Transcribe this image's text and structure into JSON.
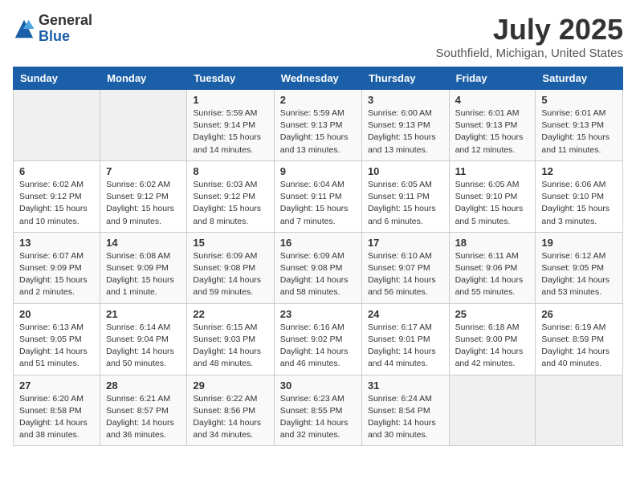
{
  "logo": {
    "general": "General",
    "blue": "Blue"
  },
  "title": "July 2025",
  "location": "Southfield, Michigan, United States",
  "days_of_week": [
    "Sunday",
    "Monday",
    "Tuesday",
    "Wednesday",
    "Thursday",
    "Friday",
    "Saturday"
  ],
  "weeks": [
    [
      {
        "day": "",
        "detail": ""
      },
      {
        "day": "",
        "detail": ""
      },
      {
        "day": "1",
        "detail": "Sunrise: 5:59 AM\nSunset: 9:14 PM\nDaylight: 15 hours\nand 14 minutes."
      },
      {
        "day": "2",
        "detail": "Sunrise: 5:59 AM\nSunset: 9:13 PM\nDaylight: 15 hours\nand 13 minutes."
      },
      {
        "day": "3",
        "detail": "Sunrise: 6:00 AM\nSunset: 9:13 PM\nDaylight: 15 hours\nand 13 minutes."
      },
      {
        "day": "4",
        "detail": "Sunrise: 6:01 AM\nSunset: 9:13 PM\nDaylight: 15 hours\nand 12 minutes."
      },
      {
        "day": "5",
        "detail": "Sunrise: 6:01 AM\nSunset: 9:13 PM\nDaylight: 15 hours\nand 11 minutes."
      }
    ],
    [
      {
        "day": "6",
        "detail": "Sunrise: 6:02 AM\nSunset: 9:12 PM\nDaylight: 15 hours\nand 10 minutes."
      },
      {
        "day": "7",
        "detail": "Sunrise: 6:02 AM\nSunset: 9:12 PM\nDaylight: 15 hours\nand 9 minutes."
      },
      {
        "day": "8",
        "detail": "Sunrise: 6:03 AM\nSunset: 9:12 PM\nDaylight: 15 hours\nand 8 minutes."
      },
      {
        "day": "9",
        "detail": "Sunrise: 6:04 AM\nSunset: 9:11 PM\nDaylight: 15 hours\nand 7 minutes."
      },
      {
        "day": "10",
        "detail": "Sunrise: 6:05 AM\nSunset: 9:11 PM\nDaylight: 15 hours\nand 6 minutes."
      },
      {
        "day": "11",
        "detail": "Sunrise: 6:05 AM\nSunset: 9:10 PM\nDaylight: 15 hours\nand 5 minutes."
      },
      {
        "day": "12",
        "detail": "Sunrise: 6:06 AM\nSunset: 9:10 PM\nDaylight: 15 hours\nand 3 minutes."
      }
    ],
    [
      {
        "day": "13",
        "detail": "Sunrise: 6:07 AM\nSunset: 9:09 PM\nDaylight: 15 hours\nand 2 minutes."
      },
      {
        "day": "14",
        "detail": "Sunrise: 6:08 AM\nSunset: 9:09 PM\nDaylight: 15 hours\nand 1 minute."
      },
      {
        "day": "15",
        "detail": "Sunrise: 6:09 AM\nSunset: 9:08 PM\nDaylight: 14 hours\nand 59 minutes."
      },
      {
        "day": "16",
        "detail": "Sunrise: 6:09 AM\nSunset: 9:08 PM\nDaylight: 14 hours\nand 58 minutes."
      },
      {
        "day": "17",
        "detail": "Sunrise: 6:10 AM\nSunset: 9:07 PM\nDaylight: 14 hours\nand 56 minutes."
      },
      {
        "day": "18",
        "detail": "Sunrise: 6:11 AM\nSunset: 9:06 PM\nDaylight: 14 hours\nand 55 minutes."
      },
      {
        "day": "19",
        "detail": "Sunrise: 6:12 AM\nSunset: 9:05 PM\nDaylight: 14 hours\nand 53 minutes."
      }
    ],
    [
      {
        "day": "20",
        "detail": "Sunrise: 6:13 AM\nSunset: 9:05 PM\nDaylight: 14 hours\nand 51 minutes."
      },
      {
        "day": "21",
        "detail": "Sunrise: 6:14 AM\nSunset: 9:04 PM\nDaylight: 14 hours\nand 50 minutes."
      },
      {
        "day": "22",
        "detail": "Sunrise: 6:15 AM\nSunset: 9:03 PM\nDaylight: 14 hours\nand 48 minutes."
      },
      {
        "day": "23",
        "detail": "Sunrise: 6:16 AM\nSunset: 9:02 PM\nDaylight: 14 hours\nand 46 minutes."
      },
      {
        "day": "24",
        "detail": "Sunrise: 6:17 AM\nSunset: 9:01 PM\nDaylight: 14 hours\nand 44 minutes."
      },
      {
        "day": "25",
        "detail": "Sunrise: 6:18 AM\nSunset: 9:00 PM\nDaylight: 14 hours\nand 42 minutes."
      },
      {
        "day": "26",
        "detail": "Sunrise: 6:19 AM\nSunset: 8:59 PM\nDaylight: 14 hours\nand 40 minutes."
      }
    ],
    [
      {
        "day": "27",
        "detail": "Sunrise: 6:20 AM\nSunset: 8:58 PM\nDaylight: 14 hours\nand 38 minutes."
      },
      {
        "day": "28",
        "detail": "Sunrise: 6:21 AM\nSunset: 8:57 PM\nDaylight: 14 hours\nand 36 minutes."
      },
      {
        "day": "29",
        "detail": "Sunrise: 6:22 AM\nSunset: 8:56 PM\nDaylight: 14 hours\nand 34 minutes."
      },
      {
        "day": "30",
        "detail": "Sunrise: 6:23 AM\nSunset: 8:55 PM\nDaylight: 14 hours\nand 32 minutes."
      },
      {
        "day": "31",
        "detail": "Sunrise: 6:24 AM\nSunset: 8:54 PM\nDaylight: 14 hours\nand 30 minutes."
      },
      {
        "day": "",
        "detail": ""
      },
      {
        "day": "",
        "detail": ""
      }
    ]
  ]
}
